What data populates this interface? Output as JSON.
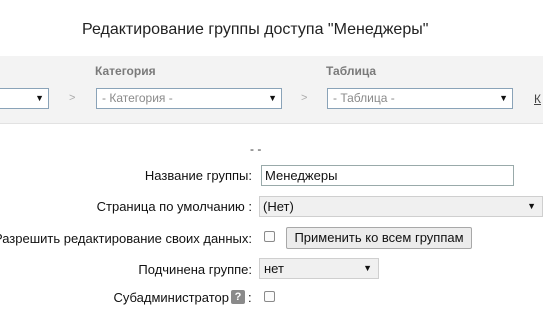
{
  "page": {
    "title": "Редактирование группы доступа \"Менеджеры\""
  },
  "filters": {
    "category_label": "Категория",
    "category_placeholder": "- Категория -",
    "table_label": "Таблица",
    "table_placeholder": "- Таблица -",
    "separator": ">",
    "trailing_link": "К"
  },
  "form": {
    "center_text": "- -",
    "group_name_label": "Название группы:",
    "group_name_value": "Менеджеры",
    "default_page_label": "Страница по умолчанию :",
    "default_page_value": "(Нет)",
    "allow_edit_label": "Разрешить редактирование своих данных:",
    "apply_all_label": "Применить ко всем группам",
    "parent_group_label": "Подчинена группе:",
    "parent_group_value": "нет",
    "subadmin_label": "Субадминистратор",
    "subadmin_colon": ":",
    "help_icon_glyph": "?"
  },
  "icons": {
    "dropdown_arrow": "▼"
  }
}
